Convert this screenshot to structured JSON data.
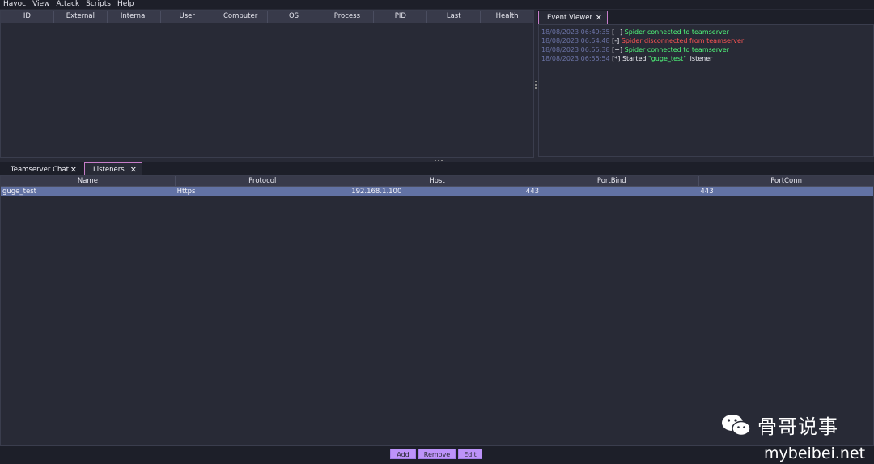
{
  "menu": [
    "Havoc",
    "View",
    "Attack",
    "Scripts",
    "Help"
  ],
  "sessions": {
    "columns": [
      "ID",
      "External",
      "Internal",
      "User",
      "Computer",
      "OS",
      "Process",
      "PID",
      "Last",
      "Health"
    ]
  },
  "event_viewer": {
    "tab_label": "Event Viewer",
    "close": "✕",
    "lines": [
      {
        "ts": "18/08/2023 06:49:35",
        "tag": "[+]",
        "msg": "Spider connected to teamserver",
        "color": "green"
      },
      {
        "ts": "18/08/2023 06:54:48",
        "tag": "[-]",
        "msg": "Spider disconnected from teamserver",
        "color": "red"
      },
      {
        "ts": "18/08/2023 06:55:38",
        "tag": "[+]",
        "msg": "Spider connected to teamserver",
        "color": "green"
      },
      {
        "ts": "18/08/2023 06:55:54",
        "tag": "[*]",
        "msg_pre": "Started ",
        "msg_hl": "\"guge_test\"",
        "msg_post": " listener",
        "color": "white"
      }
    ]
  },
  "bottom_tabs": [
    {
      "label": "Teamserver Chat",
      "close": "✕"
    },
    {
      "label": "Listeners",
      "close": "✕"
    }
  ],
  "listeners": {
    "columns": [
      "Name",
      "Protocol",
      "Host",
      "PortBind",
      "PortConn"
    ],
    "rows": [
      [
        "guge_test",
        "Https",
        "192.168.1.100",
        "443",
        "443"
      ]
    ]
  },
  "buttons": {
    "add": "Add",
    "remove": "Remove",
    "edit": "Edit"
  },
  "watermark": {
    "name": "骨哥说事",
    "url": "mybeibei.net"
  },
  "colors": {
    "accent": "#bd93f9",
    "selection": "#6272a4",
    "green": "#50fa7b",
    "red": "#ff5555",
    "bg": "#282a36"
  }
}
